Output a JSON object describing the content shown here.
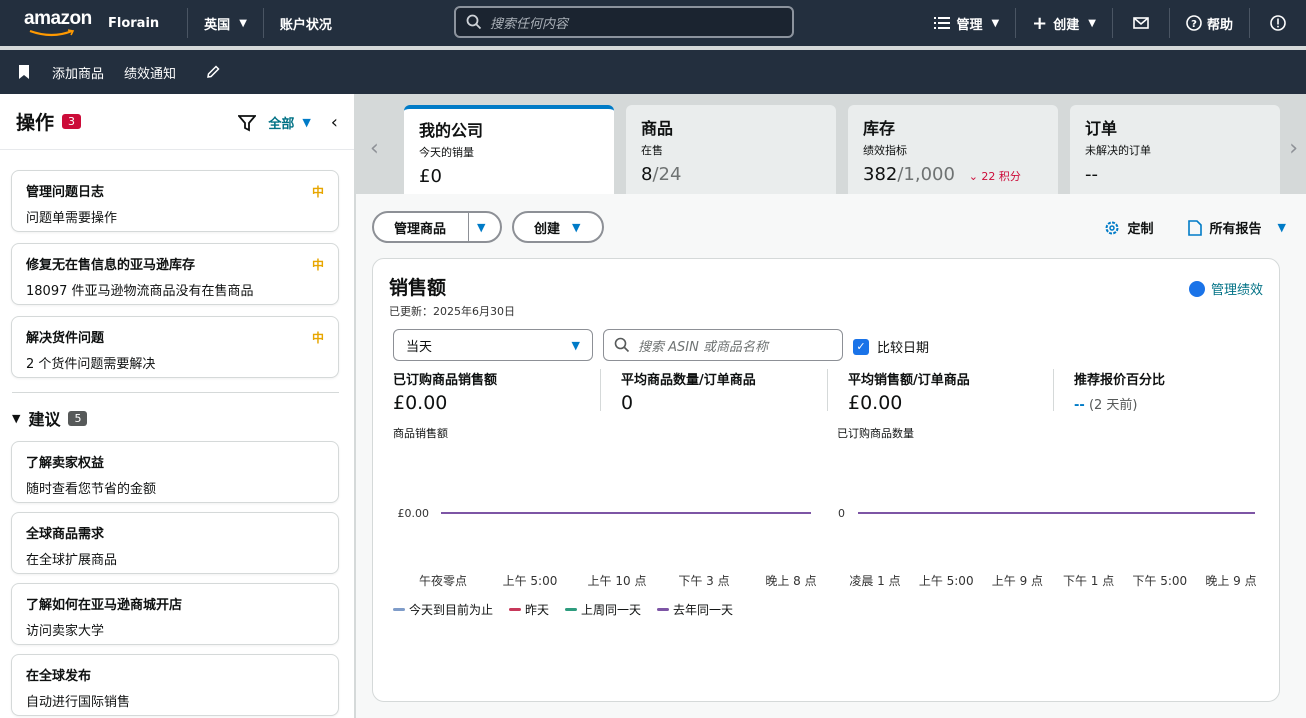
{
  "topbar": {
    "logo_text": "amazon",
    "store_name": "Florain",
    "region": "英国",
    "account_status": "账户状况",
    "search_placeholder": "搜索任何内容",
    "manage": "管理",
    "create": "创建",
    "help": "帮助"
  },
  "subbar": {
    "add_product": "添加商品",
    "performance_notice": "绩效通知"
  },
  "sidebar": {
    "title": "操作",
    "count": "3",
    "filter_label": "全部",
    "actions": [
      {
        "title": "管理问题日志",
        "desc": "问题单需要操作",
        "level": "中"
      },
      {
        "title": "修复无在售信息的亚马逊库存",
        "desc": "18097 件亚马逊物流商品没有在售商品",
        "level": "中"
      },
      {
        "title": "解决货件问题",
        "desc": "2 个货件问题需要解决",
        "level": "中"
      }
    ],
    "suggest_title": "建议",
    "suggest_count": "5",
    "suggestions": [
      {
        "title": "了解卖家权益",
        "desc": "随时查看您节省的金额"
      },
      {
        "title": "全球商品需求",
        "desc": "在全球扩展商品"
      },
      {
        "title": "了解如何在亚马逊商城开店",
        "desc": "访问卖家大学"
      },
      {
        "title": "在全球发布",
        "desc": "自动进行国际销售"
      }
    ]
  },
  "tabs": [
    {
      "title": "我的公司",
      "sub": "今天的销量",
      "value": "£0",
      "value_grey": ""
    },
    {
      "title": "商品",
      "sub": "在售",
      "value": "8",
      "value_grey": "/24"
    },
    {
      "title": "库存",
      "sub": "绩效指标",
      "value": "382",
      "value_grey": "/1,000",
      "delta": "22 积分"
    },
    {
      "title": "订单",
      "sub": "未解决的订单",
      "value": "--",
      "value_grey": ""
    }
  ],
  "toolbar": {
    "manage_products": "管理商品",
    "create": "创建",
    "customize": "定制",
    "all_reports": "所有报告"
  },
  "panel": {
    "title": "销售额",
    "updated": "已更新：2025年6月30日",
    "manage_perf": "管理绩效",
    "period": "当天",
    "search_placeholder": "搜索 ASIN 或商品名称",
    "compare": "比较日期",
    "metrics": [
      {
        "label": "已订购商品销售额",
        "value": "£0.00"
      },
      {
        "label": "平均商品数量/订单商品",
        "value": "0"
      },
      {
        "label": "平均销售额/订单商品",
        "value": "£0.00"
      },
      {
        "label": "推荐报价百分比",
        "value_dash": "--",
        "value_note": "(2 天前)"
      }
    ]
  },
  "chart_data": [
    {
      "type": "line",
      "ylabel": "商品销售额",
      "y_tick": "£0.00",
      "x_ticks": [
        "午夜零点",
        "上午 5:00",
        "上午 10 点",
        "下午 3 点",
        "晚上 8 点"
      ],
      "series": [
        {
          "name": "去年同一天",
          "values": [
            0,
            0,
            0,
            0,
            0
          ]
        }
      ]
    },
    {
      "type": "line",
      "ylabel": "已订购商品数量",
      "y_tick": "0",
      "x_ticks": [
        "凌晨 1 点",
        "上午 5:00",
        "上午 9 点",
        "下午 1 点",
        "下午 5:00",
        "晚上 9 点"
      ],
      "series": [
        {
          "name": "去年同一天",
          "values": [
            0,
            0,
            0,
            0,
            0,
            0
          ]
        }
      ]
    }
  ],
  "legend": [
    {
      "name": "今天到目前为止",
      "color": "#7f9cc9"
    },
    {
      "name": "昨天",
      "color": "#c7385a"
    },
    {
      "name": "上周同一天",
      "color": "#2e9c7e"
    },
    {
      "name": "去年同一天",
      "color": "#7d55a5"
    }
  ]
}
